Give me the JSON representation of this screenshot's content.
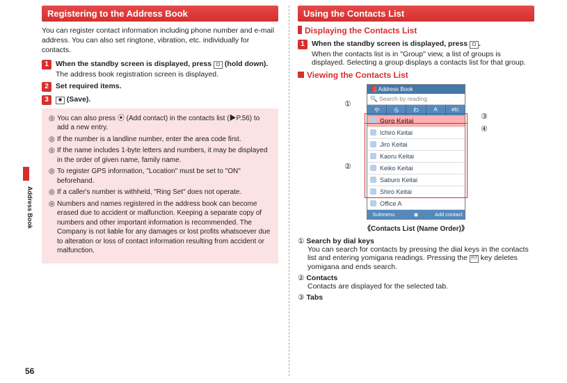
{
  "left": {
    "heading": "Registering to the Address Book",
    "intro": "You can register contact information including phone number and e-mail address. You can also set ringtone, vibration, etc. individually for contacts.",
    "steps": [
      {
        "title_a": "When the standby screen is displayed, press ",
        "title_b": " (hold down).",
        "sub": "The address book registration screen is displayed."
      },
      {
        "title_a": "Set required items.",
        "title_b": "",
        "sub": ""
      },
      {
        "title_a": "",
        "title_b": " (Save).",
        "sub": ""
      }
    ],
    "notes": [
      "You can also press ⦿ (Add contact) in the contacts list (▶P.56) to add a new entry.",
      "If the number is a landline number, enter the area code first.",
      "If the name includes 1-byte letters and numbers, it may be displayed in the order of given name, family name.",
      "To register GPS information, \"Location\" must be set to \"ON\" beforehand.",
      "If a caller's number is withheld, \"Ring Set\" does not operate.",
      "Numbers and names registered in the address book can become erased due to accident or malfunction. Keeping a separate copy of numbers and other important information is recommended. The Company is not liable for any damages or lost profits whatsoever due to alteration or loss of contact information resulting from accident or malfunction."
    ]
  },
  "right": {
    "heading": "Using the Contacts List",
    "sub1": "Displaying the Contacts List",
    "step1_a": "When the standby screen is displayed, press ",
    "step1_b": ".",
    "step1_sub": "When the contacts list is in \"Group\" view, a list of groups is displayed. Selecting a group displays a contacts list for that group.",
    "sub2": "Viewing the Contacts List",
    "phone": {
      "title": "Address Book",
      "search": "Search by reading",
      "tabs": [
        "や",
        "ら",
        "わ",
        "A",
        "etc"
      ],
      "rows": [
        "Goro Keitai",
        "Ichiro Keitai",
        "Jiro Keitai",
        "Kaoru Keitai",
        "Keiko Keitai",
        "Saburo Keitai",
        "Shiro Keitai",
        "Office A"
      ],
      "soft_left": "Submenu",
      "soft_right": "Add contact"
    },
    "callout_labels": {
      "c1": "①",
      "c2": "②",
      "c3": "③",
      "c4": "④"
    },
    "caption": "《Contacts List (Name Order)》",
    "legends": [
      {
        "num": "①",
        "title": "Search by dial keys",
        "desc_a": "You can search for contacts by pressing the dial keys in the contacts list and entering yomigana readings. Pressing the ",
        "desc_b": " key deletes yomigana and ends search.",
        "key": "ｸﾘｱ"
      },
      {
        "num": "②",
        "title": "Contacts",
        "desc_a": "Contacts are displayed for the selected tab.",
        "desc_b": "",
        "key": ""
      },
      {
        "num": "③",
        "title": "Tabs",
        "desc_a": "",
        "desc_b": "",
        "key": ""
      }
    ]
  },
  "side": {
    "label": "Address Book",
    "page": "56"
  }
}
